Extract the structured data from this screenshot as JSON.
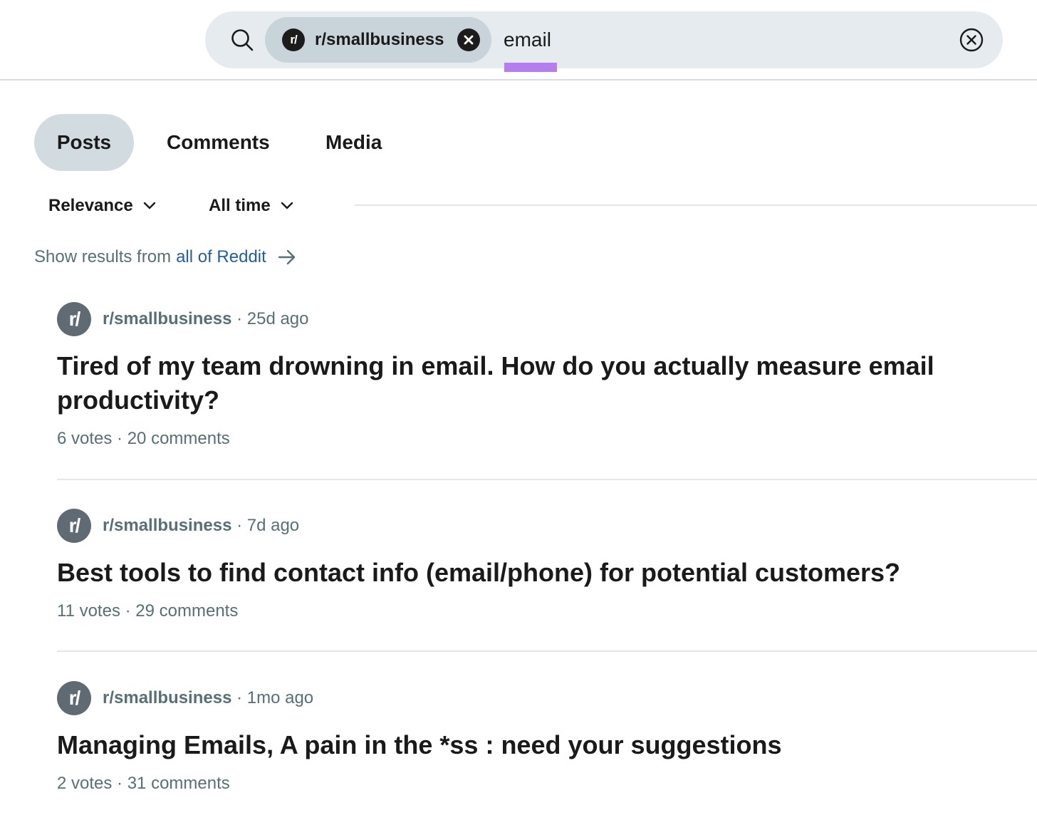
{
  "search": {
    "community_chip": {
      "avatar_text": "r/",
      "label": "r/smallbusiness"
    },
    "query": "email"
  },
  "tabs": [
    {
      "label": "Posts",
      "active": true
    },
    {
      "label": "Comments",
      "active": false
    },
    {
      "label": "Media",
      "active": false
    }
  ],
  "filters": {
    "sort": "Relevance",
    "time": "All time"
  },
  "results_scope": {
    "prefix": "Show results from",
    "link": "all of Reddit"
  },
  "posts": [
    {
      "avatar_text": "r/",
      "subreddit": "r/smallbusiness",
      "age": " · 25d ago",
      "title": "Tired of my team drowning in email. How do you actually measure email productivity?",
      "stats": "6 votes · 20 comments"
    },
    {
      "avatar_text": "r/",
      "subreddit": "r/smallbusiness",
      "age": " · 7d ago",
      "title": "Best tools to find contact info (email/phone) for potential customers?",
      "stats": "11 votes · 29 comments"
    },
    {
      "avatar_text": "r/",
      "subreddit": "r/smallbusiness",
      "age": " · 1mo ago",
      "title": "Managing Emails, A pain in the *ss : need your suggestions",
      "stats": "2 votes · 31 comments"
    }
  ],
  "colors": {
    "search_bg": "#e5ebee",
    "chip_bg": "#c8d3da",
    "active_tab_bg": "#d2dbe0",
    "link": "#1f5ea8",
    "muted_text": "#576f76",
    "spellcheck_underline": "#b57eef"
  }
}
